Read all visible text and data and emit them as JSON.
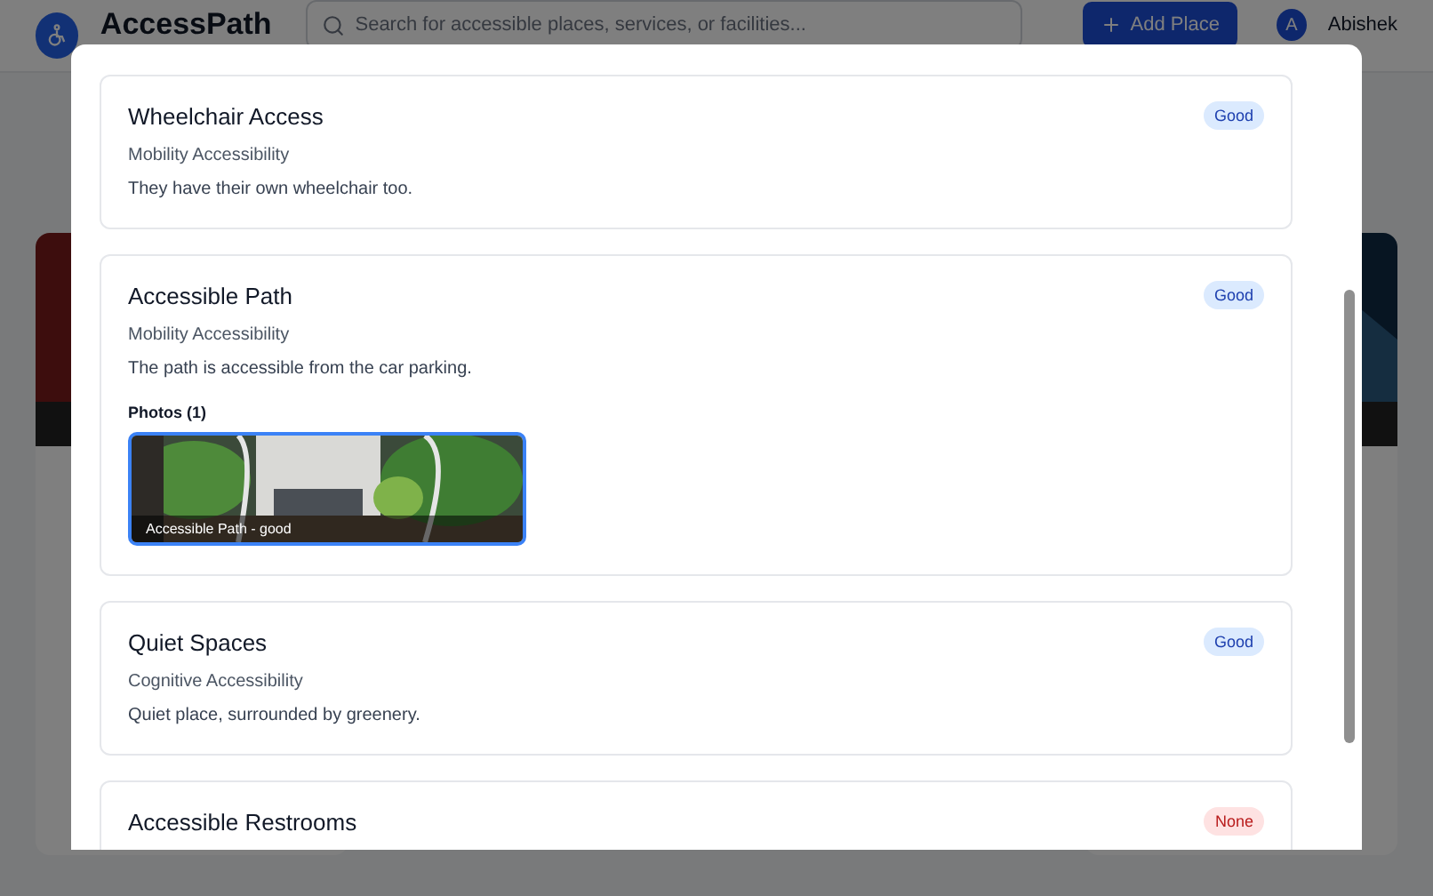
{
  "header": {
    "app_name": "AccessPath",
    "search": {
      "placeholder": "Search for accessible places, services, or facilities..."
    },
    "add_button": "Add Place",
    "user": {
      "initial": "A",
      "name": "Abishek"
    }
  },
  "features": [
    {
      "title": "Wheelchair Access",
      "category": "Mobility Accessibility",
      "description": "They have their own wheelchair too.",
      "rating": "Good",
      "kind": "good"
    },
    {
      "title": "Accessible Path",
      "category": "Mobility Accessibility",
      "description": "The path is accessible from the car parking.",
      "rating": "Good",
      "kind": "good",
      "photos_label": "Photos (1)",
      "photos": [
        {
          "caption": "Accessible Path - good",
          "selected": true
        }
      ]
    },
    {
      "title": "Quiet Spaces",
      "category": "Cognitive Accessibility",
      "description": "Quiet place, surrounded by greenery.",
      "rating": "Good",
      "kind": "good"
    },
    {
      "title": "Accessible Restrooms",
      "rating": "None",
      "kind": "none"
    }
  ]
}
